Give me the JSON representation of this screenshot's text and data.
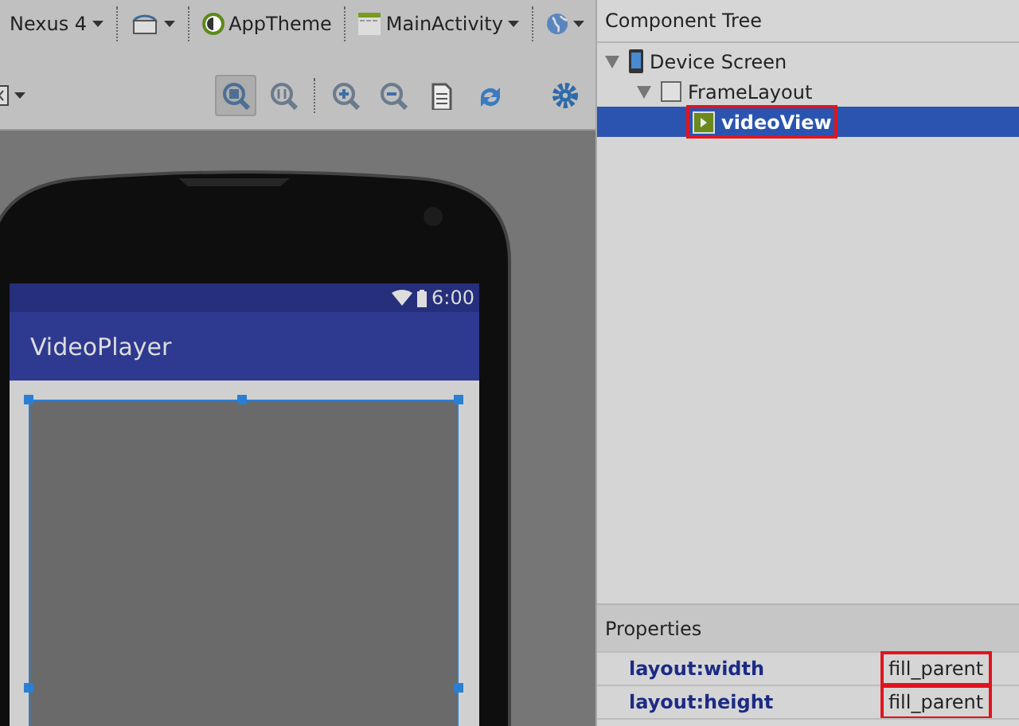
{
  "toolbar": {
    "device": "Nexus 4",
    "theme": "AppTheme",
    "activity": "MainActivity"
  },
  "view_tools": [
    {
      "kind": "zoom-fit",
      "pressed": true
    },
    {
      "kind": "zoom-actual",
      "pressed": false
    },
    {
      "kind": "zoom-in",
      "pressed": false
    },
    {
      "kind": "zoom-out",
      "pressed": false
    },
    {
      "kind": "document",
      "pressed": false
    },
    {
      "kind": "refresh",
      "pressed": false
    },
    {
      "kind": "settings",
      "pressed": false
    }
  ],
  "preview": {
    "status_time": "6:00",
    "app_title": "VideoPlayer"
  },
  "component_tree": {
    "title": "Component Tree",
    "items": [
      {
        "label": "Device Screen",
        "kind": "device",
        "expanded": true,
        "selected": false,
        "highlighted": false,
        "children": [
          {
            "label": "FrameLayout",
            "kind": "layout",
            "expanded": true,
            "selected": false,
            "highlighted": false,
            "children": [
              {
                "label": "videoView",
                "kind": "video",
                "selected": true,
                "highlighted": true
              }
            ]
          }
        ]
      }
    ]
  },
  "properties": {
    "title": "Properties",
    "rows": [
      {
        "name": "layout:width",
        "value": "fill_parent",
        "highlighted": true
      },
      {
        "name": "layout:height",
        "value": "fill_parent",
        "highlighted": true
      }
    ]
  }
}
